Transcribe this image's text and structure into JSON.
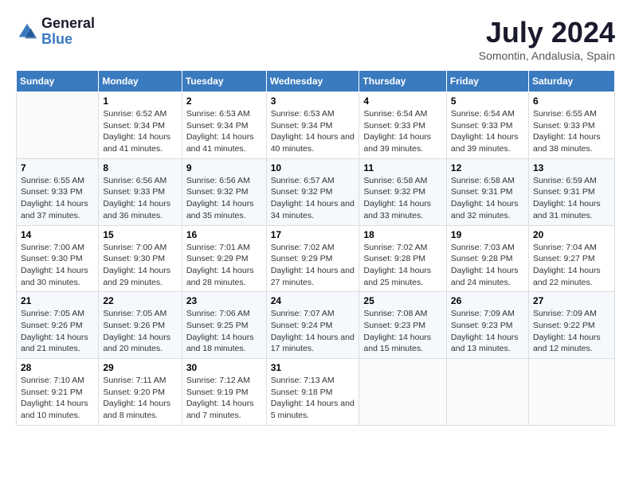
{
  "logo": {
    "line1": "General",
    "line2": "Blue"
  },
  "title": "July 2024",
  "location": "Somontin, Andalusia, Spain",
  "weekdays": [
    "Sunday",
    "Monday",
    "Tuesday",
    "Wednesday",
    "Thursday",
    "Friday",
    "Saturday"
  ],
  "weeks": [
    [
      {
        "day": "",
        "sunrise": "",
        "sunset": "",
        "daylight": ""
      },
      {
        "day": "1",
        "sunrise": "Sunrise: 6:52 AM",
        "sunset": "Sunset: 9:34 PM",
        "daylight": "Daylight: 14 hours and 41 minutes."
      },
      {
        "day": "2",
        "sunrise": "Sunrise: 6:53 AM",
        "sunset": "Sunset: 9:34 PM",
        "daylight": "Daylight: 14 hours and 41 minutes."
      },
      {
        "day": "3",
        "sunrise": "Sunrise: 6:53 AM",
        "sunset": "Sunset: 9:34 PM",
        "daylight": "Daylight: 14 hours and 40 minutes."
      },
      {
        "day": "4",
        "sunrise": "Sunrise: 6:54 AM",
        "sunset": "Sunset: 9:33 PM",
        "daylight": "Daylight: 14 hours and 39 minutes."
      },
      {
        "day": "5",
        "sunrise": "Sunrise: 6:54 AM",
        "sunset": "Sunset: 9:33 PM",
        "daylight": "Daylight: 14 hours and 39 minutes."
      },
      {
        "day": "6",
        "sunrise": "Sunrise: 6:55 AM",
        "sunset": "Sunset: 9:33 PM",
        "daylight": "Daylight: 14 hours and 38 minutes."
      }
    ],
    [
      {
        "day": "7",
        "sunrise": "Sunrise: 6:55 AM",
        "sunset": "Sunset: 9:33 PM",
        "daylight": "Daylight: 14 hours and 37 minutes."
      },
      {
        "day": "8",
        "sunrise": "Sunrise: 6:56 AM",
        "sunset": "Sunset: 9:33 PM",
        "daylight": "Daylight: 14 hours and 36 minutes."
      },
      {
        "day": "9",
        "sunrise": "Sunrise: 6:56 AM",
        "sunset": "Sunset: 9:32 PM",
        "daylight": "Daylight: 14 hours and 35 minutes."
      },
      {
        "day": "10",
        "sunrise": "Sunrise: 6:57 AM",
        "sunset": "Sunset: 9:32 PM",
        "daylight": "Daylight: 14 hours and 34 minutes."
      },
      {
        "day": "11",
        "sunrise": "Sunrise: 6:58 AM",
        "sunset": "Sunset: 9:32 PM",
        "daylight": "Daylight: 14 hours and 33 minutes."
      },
      {
        "day": "12",
        "sunrise": "Sunrise: 6:58 AM",
        "sunset": "Sunset: 9:31 PM",
        "daylight": "Daylight: 14 hours and 32 minutes."
      },
      {
        "day": "13",
        "sunrise": "Sunrise: 6:59 AM",
        "sunset": "Sunset: 9:31 PM",
        "daylight": "Daylight: 14 hours and 31 minutes."
      }
    ],
    [
      {
        "day": "14",
        "sunrise": "Sunrise: 7:00 AM",
        "sunset": "Sunset: 9:30 PM",
        "daylight": "Daylight: 14 hours and 30 minutes."
      },
      {
        "day": "15",
        "sunrise": "Sunrise: 7:00 AM",
        "sunset": "Sunset: 9:30 PM",
        "daylight": "Daylight: 14 hours and 29 minutes."
      },
      {
        "day": "16",
        "sunrise": "Sunrise: 7:01 AM",
        "sunset": "Sunset: 9:29 PM",
        "daylight": "Daylight: 14 hours and 28 minutes."
      },
      {
        "day": "17",
        "sunrise": "Sunrise: 7:02 AM",
        "sunset": "Sunset: 9:29 PM",
        "daylight": "Daylight: 14 hours and 27 minutes."
      },
      {
        "day": "18",
        "sunrise": "Sunrise: 7:02 AM",
        "sunset": "Sunset: 9:28 PM",
        "daylight": "Daylight: 14 hours and 25 minutes."
      },
      {
        "day": "19",
        "sunrise": "Sunrise: 7:03 AM",
        "sunset": "Sunset: 9:28 PM",
        "daylight": "Daylight: 14 hours and 24 minutes."
      },
      {
        "day": "20",
        "sunrise": "Sunrise: 7:04 AM",
        "sunset": "Sunset: 9:27 PM",
        "daylight": "Daylight: 14 hours and 22 minutes."
      }
    ],
    [
      {
        "day": "21",
        "sunrise": "Sunrise: 7:05 AM",
        "sunset": "Sunset: 9:26 PM",
        "daylight": "Daylight: 14 hours and 21 minutes."
      },
      {
        "day": "22",
        "sunrise": "Sunrise: 7:05 AM",
        "sunset": "Sunset: 9:26 PM",
        "daylight": "Daylight: 14 hours and 20 minutes."
      },
      {
        "day": "23",
        "sunrise": "Sunrise: 7:06 AM",
        "sunset": "Sunset: 9:25 PM",
        "daylight": "Daylight: 14 hours and 18 minutes."
      },
      {
        "day": "24",
        "sunrise": "Sunrise: 7:07 AM",
        "sunset": "Sunset: 9:24 PM",
        "daylight": "Daylight: 14 hours and 17 minutes."
      },
      {
        "day": "25",
        "sunrise": "Sunrise: 7:08 AM",
        "sunset": "Sunset: 9:23 PM",
        "daylight": "Daylight: 14 hours and 15 minutes."
      },
      {
        "day": "26",
        "sunrise": "Sunrise: 7:09 AM",
        "sunset": "Sunset: 9:23 PM",
        "daylight": "Daylight: 14 hours and 13 minutes."
      },
      {
        "day": "27",
        "sunrise": "Sunrise: 7:09 AM",
        "sunset": "Sunset: 9:22 PM",
        "daylight": "Daylight: 14 hours and 12 minutes."
      }
    ],
    [
      {
        "day": "28",
        "sunrise": "Sunrise: 7:10 AM",
        "sunset": "Sunset: 9:21 PM",
        "daylight": "Daylight: 14 hours and 10 minutes."
      },
      {
        "day": "29",
        "sunrise": "Sunrise: 7:11 AM",
        "sunset": "Sunset: 9:20 PM",
        "daylight": "Daylight: 14 hours and 8 minutes."
      },
      {
        "day": "30",
        "sunrise": "Sunrise: 7:12 AM",
        "sunset": "Sunset: 9:19 PM",
        "daylight": "Daylight: 14 hours and 7 minutes."
      },
      {
        "day": "31",
        "sunrise": "Sunrise: 7:13 AM",
        "sunset": "Sunset: 9:18 PM",
        "daylight": "Daylight: 14 hours and 5 minutes."
      },
      {
        "day": "",
        "sunrise": "",
        "sunset": "",
        "daylight": ""
      },
      {
        "day": "",
        "sunrise": "",
        "sunset": "",
        "daylight": ""
      },
      {
        "day": "",
        "sunrise": "",
        "sunset": "",
        "daylight": ""
      }
    ]
  ]
}
